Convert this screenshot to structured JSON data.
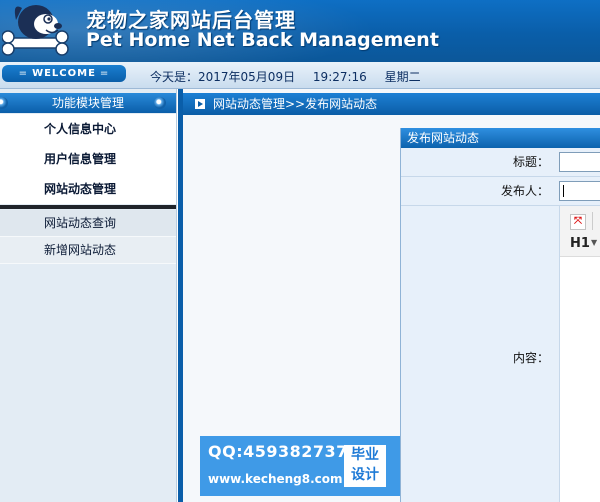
{
  "header": {
    "title_cn": "宠物之家网站后台管理",
    "title_en": "Pet Home Net Back Management",
    "logo_icon": "dog-bone-logo-icon",
    "color_primary": "#0a5ea9"
  },
  "statusbar": {
    "welcome": "WELCOME",
    "date_prefix": "今天是：2017年05月09日",
    "time": "19:27:16",
    "weekday": "星期二"
  },
  "sidebar": {
    "header": "功能模块管理",
    "items": [
      {
        "label": "个人信息中心"
      },
      {
        "label": "用户信息管理"
      },
      {
        "label": "网站动态管理"
      }
    ],
    "subitems": [
      {
        "label": "网站动态查询"
      },
      {
        "label": "新增网站动态"
      }
    ]
  },
  "main": {
    "breadcrumb": "网站动态管理>>发布网站动态",
    "form": {
      "title": "发布网站动态",
      "fields": [
        {
          "label": "标题：",
          "value": ""
        },
        {
          "label": "发布人：",
          "value": ""
        },
        {
          "label": "内容：",
          "value": ""
        }
      ],
      "editor": {
        "fullscreen_icon": "fullscreen-icon",
        "heading_label": "H1",
        "heading_icon": "chevron-down-icon"
      }
    }
  },
  "watermark": {
    "qq": "QQ:459382737",
    "url": "www.kecheng8.com",
    "seal_line1": "毕业",
    "seal_line2": "设计"
  }
}
